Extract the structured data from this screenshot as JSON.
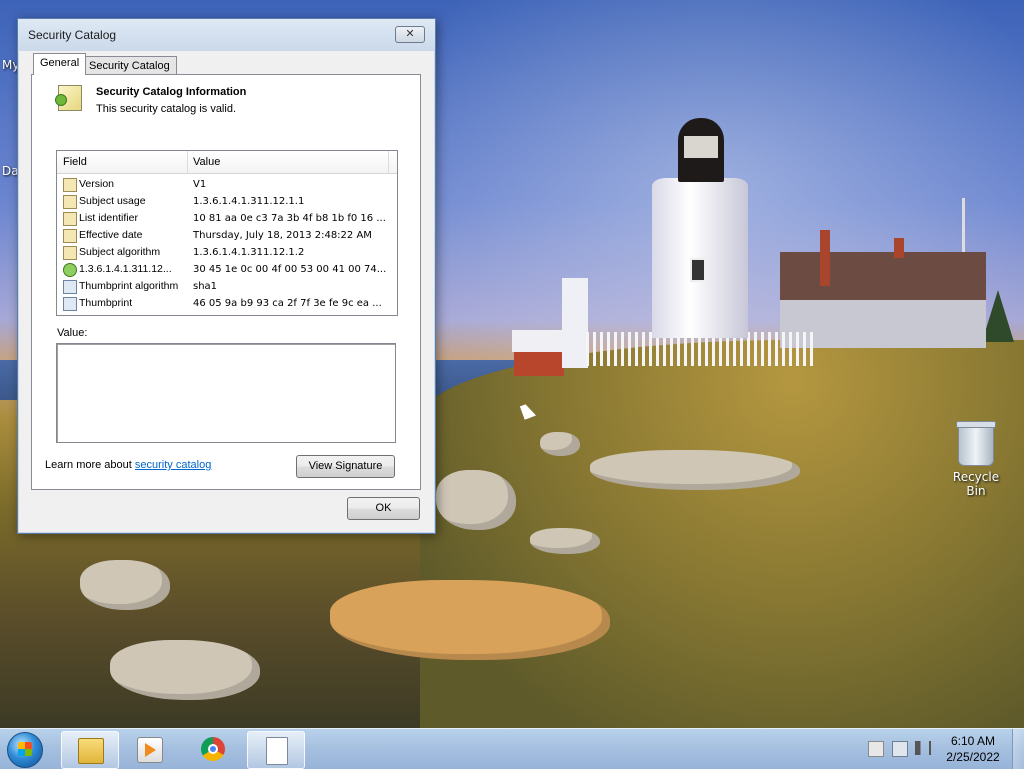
{
  "desktop": {
    "left_labels": [
      "My",
      "Da"
    ],
    "recycle_bin_label": "Recycle Bin"
  },
  "dialog": {
    "title": "Security Catalog",
    "close_glyph": "✕",
    "tabs": [
      {
        "label": "General",
        "active": true
      },
      {
        "label": "Security Catalog",
        "active": false
      }
    ],
    "info_title": "Security Catalog Information",
    "info_subtitle": "This security catalog is valid.",
    "list": {
      "headers": [
        "Field",
        "Value"
      ],
      "rows": [
        {
          "icon": "certificate-field-icon",
          "field": "Version",
          "value": "V1"
        },
        {
          "icon": "certificate-field-icon",
          "field": "Subject usage",
          "value": "1.3.6.1.4.1.311.12.1.1"
        },
        {
          "icon": "certificate-field-icon",
          "field": "List identifier",
          "value": "10 81 aa 0e c3 7a 3b 4f b8 1b f0 16 ..."
        },
        {
          "icon": "certificate-field-icon",
          "field": "Effective date",
          "value": "Thursday, July 18, 2013 2:48:22 AM"
        },
        {
          "icon": "certificate-field-icon",
          "field": "Subject algorithm",
          "value": "1.3.6.1.4.1.311.12.1.2"
        },
        {
          "icon": "extension-icon",
          "field": "1.3.6.1.4.1.311.12...",
          "value": "30 45 1e 0c 00 4f 00 53 00 41 00 74..."
        },
        {
          "icon": "property-icon",
          "field": "Thumbprint algorithm",
          "value": "sha1"
        },
        {
          "icon": "property-icon",
          "field": "Thumbprint",
          "value": "46 05 9a b9 93 ca 2f 7f 3e fe 9c ea ..."
        }
      ]
    },
    "value_label": "Value:",
    "value_text": "",
    "learn_prefix": "Learn more about ",
    "learn_link": "security catalog",
    "view_signature_label": "View Signature",
    "ok_label": "OK"
  },
  "taskbar": {
    "start_label": "Start",
    "apps": [
      {
        "name": "windows-explorer-icon",
        "active": true
      },
      {
        "name": "media-player-icon",
        "active": false
      },
      {
        "name": "chrome-icon",
        "active": false
      },
      {
        "name": "file-icon",
        "active": true
      }
    ],
    "time": "6:10 AM",
    "date": "2/25/2022"
  },
  "colors": {
    "link": "#0066cc",
    "dialog_border": "#5a7ea8",
    "taskbar": "#a4bfdf"
  }
}
